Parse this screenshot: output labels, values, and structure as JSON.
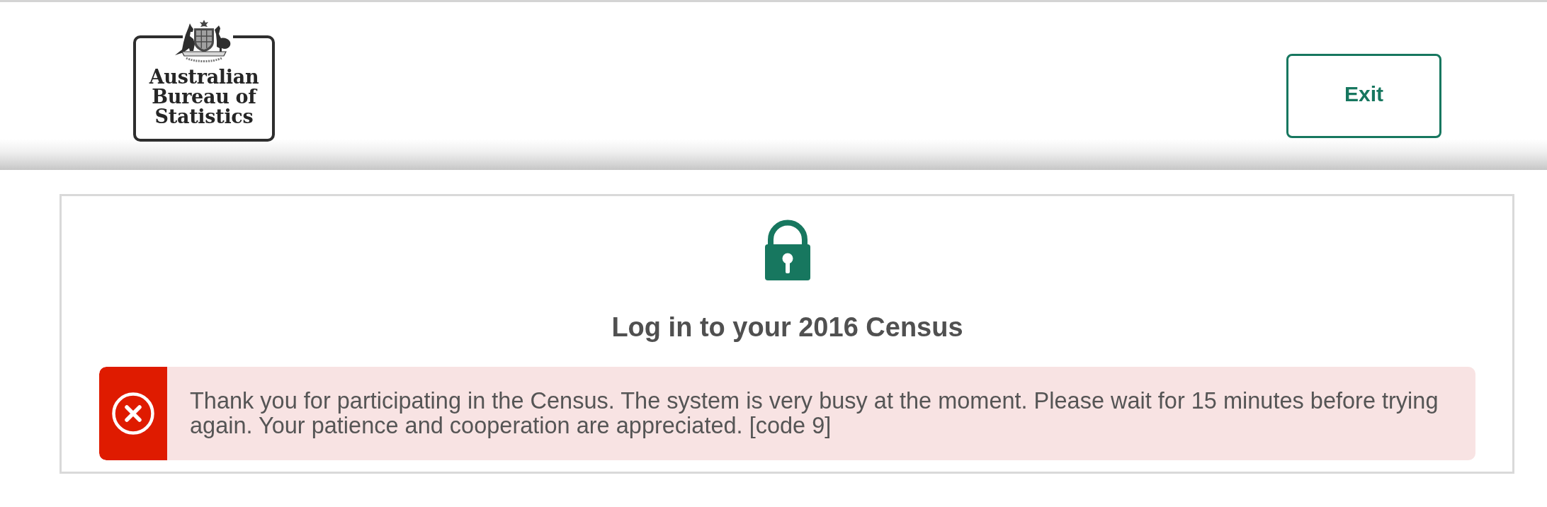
{
  "header": {
    "logo": {
      "lines": [
        "Australian",
        "Bureau of",
        "Statistics"
      ]
    },
    "exit_button": {
      "label": "Exit"
    }
  },
  "login_card": {
    "title": "Log in to your 2016 Census",
    "alert": {
      "kind": "error",
      "message": "Thank you for participating in the Census. The system is very busy at the moment. Please wait for 15 minutes before trying again. Your patience and cooperation are appreciated. [code 9]"
    }
  }
}
